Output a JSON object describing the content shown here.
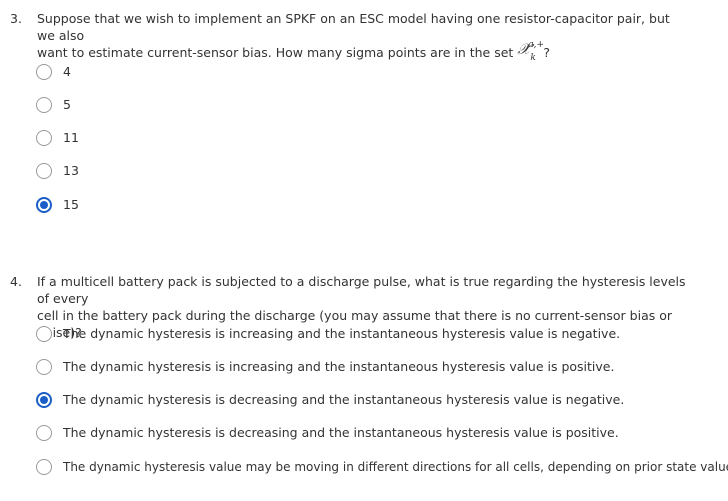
{
  "questions": [
    {
      "number": "3.",
      "text_line1": "Suppose that we wish to implement an SPKF on an ESC model having one resistor-capacitor pair, but we also",
      "text_line2": "want to estimate current-sensor bias. How many sigma points are in the set",
      "math_symbol": "𝒳",
      "math_sup": "a,+",
      "math_sub": "k",
      "text_end": "?",
      "options": [
        {
          "label": "4",
          "selected": false
        },
        {
          "label": "5",
          "selected": false
        },
        {
          "label": "11",
          "selected": false
        },
        {
          "label": "13",
          "selected": false
        },
        {
          "label": "15",
          "selected": true
        }
      ]
    },
    {
      "number": "4.",
      "text_line1": "If a multicell battery pack is subjected to a discharge pulse, what is true regarding the hysteresis levels of every",
      "text_line2": "cell in the battery pack during the discharge (you may assume that there is no current-sensor bias or noise)?",
      "options": [
        {
          "label": "The dynamic hysteresis is increasing and the instantaneous hysteresis value is negative.",
          "selected": false
        },
        {
          "label": "The dynamic hysteresis is increasing and the instantaneous hysteresis value is positive.",
          "selected": false
        },
        {
          "label": "The dynamic hysteresis is decreasing and the instantaneous hysteresis value is negative.",
          "selected": true
        },
        {
          "label": "The dynamic hysteresis is decreasing and the instantaneous hysteresis value is positive.",
          "selected": false
        },
        {
          "label": "The dynamic hysteresis value may be moving in different directions for all cells, depending on prior state values.",
          "selected": false
        }
      ]
    }
  ],
  "colors": {
    "text": "#333333",
    "radio_border": "#9a9a9a",
    "radio_selected": "#1a5fc7"
  }
}
